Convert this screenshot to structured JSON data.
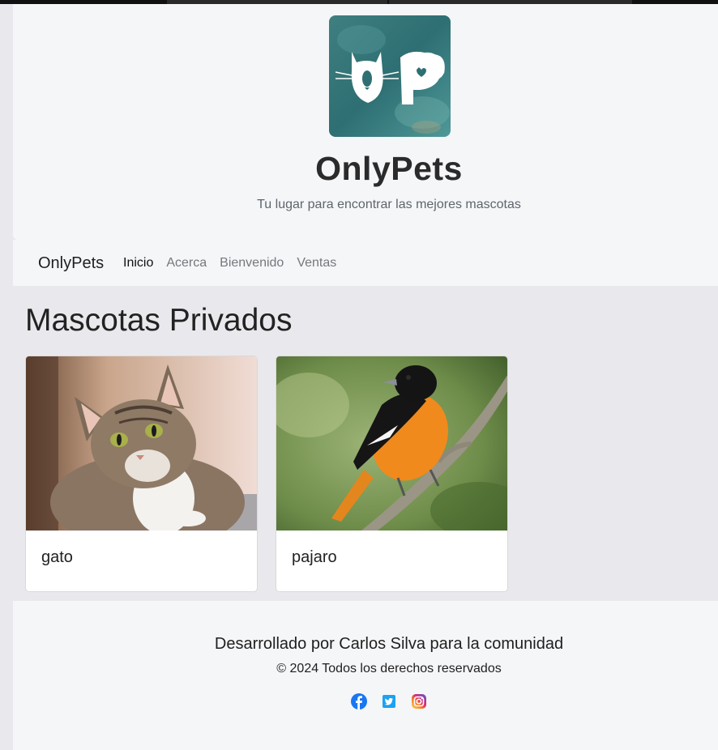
{
  "header": {
    "logo_alt": "OnlyPets logo",
    "title": "OnlyPets",
    "subtitle": "Tu lugar para encontrar las mejores mascotas"
  },
  "navbar": {
    "brand": "OnlyPets",
    "links": [
      {
        "label": "Inicio",
        "active": true
      },
      {
        "label": "Acerca",
        "active": false
      },
      {
        "label": "Bienvenido",
        "active": false
      },
      {
        "label": "Ventas",
        "active": false
      }
    ]
  },
  "main": {
    "title": "Mascotas Privados",
    "cards": [
      {
        "name": "gato",
        "image": "cat-photo"
      },
      {
        "name": "pajaro",
        "image": "bird-photo"
      }
    ]
  },
  "footer": {
    "credit": "Desarrollado por Carlos Silva para la comunidad",
    "copyright": "© 2024 Todos los derechos reservados",
    "social": [
      {
        "name": "facebook-icon",
        "color": "#1877f2"
      },
      {
        "name": "twitter-icon",
        "color": "#1da1f2"
      },
      {
        "name": "instagram-icon",
        "color": "#c13584"
      }
    ]
  }
}
